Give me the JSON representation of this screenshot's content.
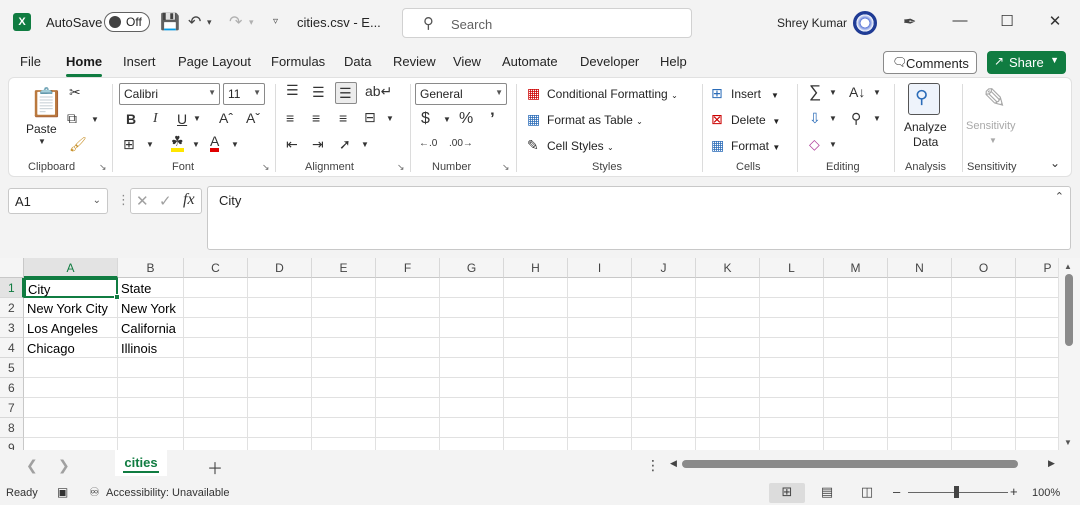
{
  "titlebar": {
    "autosave_label": "AutoSave",
    "autosave_state": "Off",
    "filename": "cities.csv  -  E...",
    "search_placeholder": "Search",
    "user_name": "Shrey Kumar"
  },
  "menu": {
    "tabs": [
      "File",
      "Home",
      "Insert",
      "Page Layout",
      "Formulas",
      "Data",
      "Review",
      "View",
      "Automate",
      "Developer",
      "Help"
    ],
    "active": "Home",
    "comments_label": "Comments",
    "share_label": "Share"
  },
  "ribbon": {
    "clipboard": {
      "label": "Clipboard",
      "paste": "Paste"
    },
    "font": {
      "label": "Font",
      "font_name": "Calibri",
      "font_size": "11"
    },
    "alignment": {
      "label": "Alignment"
    },
    "number": {
      "label": "Number",
      "format": "General"
    },
    "styles": {
      "label": "Styles",
      "conditional": "Conditional Formatting",
      "format_table": "Format as Table",
      "cell_styles": "Cell Styles"
    },
    "cells": {
      "label": "Cells",
      "insert": "Insert",
      "delete": "Delete",
      "format": "Format"
    },
    "editing": {
      "label": "Editing"
    },
    "analysis": {
      "label": "Analysis",
      "analyze_line1": "Analyze",
      "analyze_line2": "Data"
    },
    "sensitivity": {
      "label": "Sensitivity",
      "button": "Sensitivity"
    }
  },
  "formula_bar": {
    "name_box": "A1",
    "content": "City"
  },
  "grid": {
    "columns": [
      "A",
      "B",
      "C",
      "D",
      "E",
      "F",
      "G",
      "H",
      "I",
      "J",
      "K",
      "L",
      "M",
      "N",
      "O",
      "P"
    ],
    "rows": [
      "1",
      "2",
      "3",
      "4",
      "5",
      "6",
      "7",
      "8",
      "9"
    ],
    "cells": [
      [
        "City",
        "State"
      ],
      [
        "New York City",
        "New York"
      ],
      [
        "Los Angeles",
        "California"
      ],
      [
        "Chicago",
        "Illinois"
      ]
    ]
  },
  "sheets": {
    "tabs": [
      "cities"
    ],
    "active": "cities"
  },
  "status": {
    "ready": "Ready",
    "accessibility": "Accessibility: Unavailable",
    "zoom": "100%"
  },
  "colors": {
    "accent": "#107c41"
  }
}
